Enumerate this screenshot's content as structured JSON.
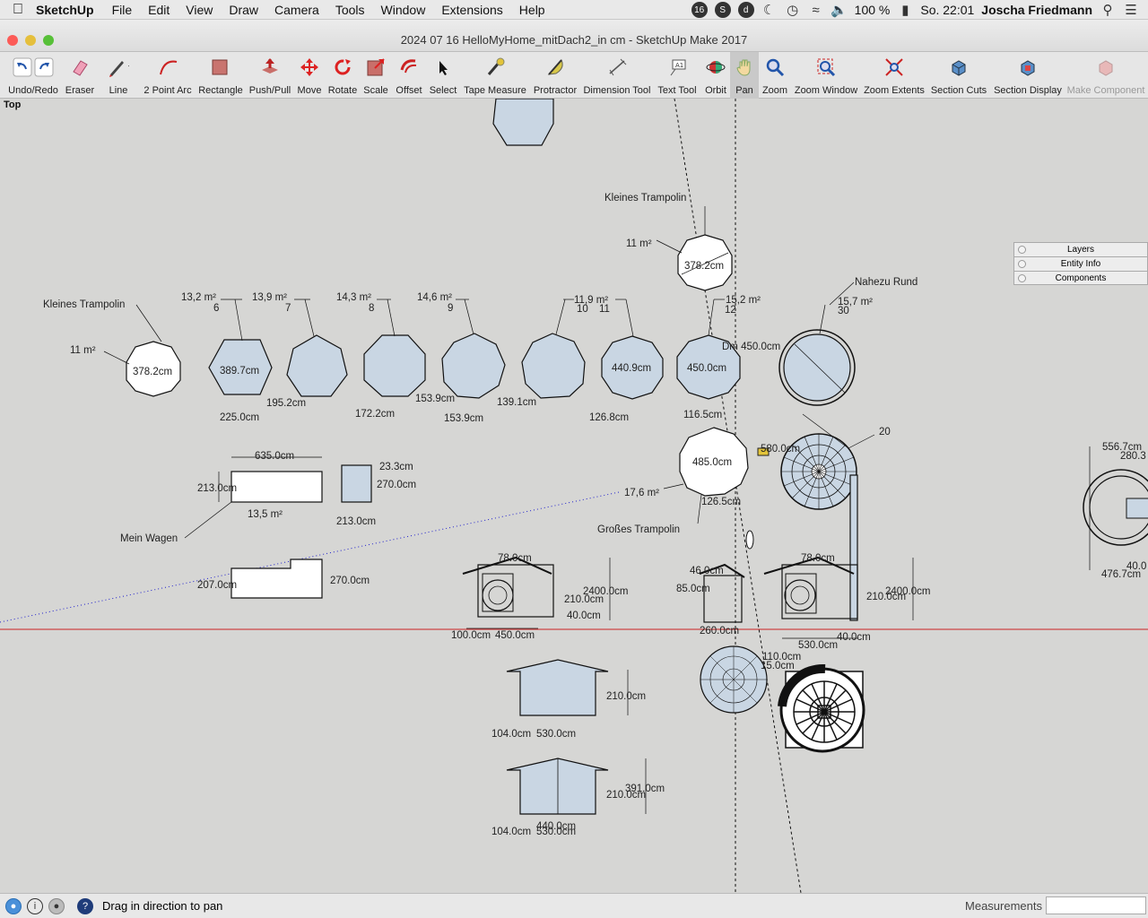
{
  "menubar": {
    "app_name": "SketchUp",
    "items": [
      "File",
      "Edit",
      "View",
      "Draw",
      "Camera",
      "Tools",
      "Window",
      "Extensions",
      "Help"
    ],
    "battery": "100 %",
    "clock": "So. 22:01",
    "user": "Joscha Friedmann"
  },
  "window": {
    "title": "2024 07 16 HelloMyHome_mitDach2_in cm - SketchUp Make 2017"
  },
  "toolbar": {
    "tools": [
      {
        "label": "Undo/Redo",
        "icon": "undo-redo-icon"
      },
      {
        "label": "Eraser",
        "icon": "eraser-icon"
      },
      {
        "label": "Line",
        "icon": "pencil-icon"
      },
      {
        "label": "2 Point Arc",
        "icon": "arc-icon"
      },
      {
        "label": "Rectangle",
        "icon": "rectangle-icon"
      },
      {
        "label": "Push/Pull",
        "icon": "push-pull-icon"
      },
      {
        "label": "Move",
        "icon": "move-icon"
      },
      {
        "label": "Rotate",
        "icon": "rotate-icon"
      },
      {
        "label": "Scale",
        "icon": "scale-icon"
      },
      {
        "label": "Offset",
        "icon": "offset-icon"
      },
      {
        "label": "Select",
        "icon": "arrow-icon"
      },
      {
        "label": "Tape Measure",
        "icon": "tape-measure-icon"
      },
      {
        "label": "Protractor",
        "icon": "protractor-icon"
      },
      {
        "label": "Dimension Tool",
        "icon": "dimension-icon"
      },
      {
        "label": "Text Tool",
        "icon": "text-icon"
      },
      {
        "label": "Orbit",
        "icon": "orbit-icon"
      },
      {
        "label": "Pan",
        "icon": "hand-icon"
      },
      {
        "label": "Zoom",
        "icon": "magnifier-icon"
      },
      {
        "label": "Zoom Window",
        "icon": "zoom-window-icon"
      },
      {
        "label": "Zoom Extents",
        "icon": "zoom-extents-icon"
      },
      {
        "label": "Section Cuts",
        "icon": "section-cuts-icon"
      },
      {
        "label": "Section Display",
        "icon": "section-display-icon"
      },
      {
        "label": "Make Component",
        "icon": "component-icon"
      }
    ]
  },
  "viewport": {
    "view_name": "Top",
    "labels": {
      "kt_top": "Kleines Trampolin",
      "kt_top_area": "11 m²",
      "kt_top_diam": "378.2cm",
      "kt_left": "Kleines Trampolin",
      "kt_left_area": "11 m²",
      "kt_left_diam": "378.2cm",
      "rund": "Nahezu Rund",
      "a1": "13,2 m²",
      "n1": "6",
      "a2": "13,9 m²",
      "n2": "7",
      "a3": "14,3 m²",
      "n3": "8",
      "a4": "14,6 m²",
      "n4": "9",
      "a5": "11,9 m²",
      "n5": "10",
      "n6": "11",
      "a7": "15,2 m²",
      "n7": "12",
      "a8": "15,7 m²",
      "n8": "30",
      "d1": "389.7cm",
      "d2": "440.9cm",
      "d3": "450.0cm",
      "d4": "Dm 450.0cm",
      "s1": "225.0cm",
      "s2": "195.2cm",
      "s3": "172.2cm",
      "s4": "153.9cm",
      "s5": "153.9cm",
      "s6": "139.1cm",
      "s7": "126.8cm",
      "s8": "116.5cm",
      "gt_diam": "485.0cm",
      "gt_area": "17,6 m²",
      "gt_side": "126.5cm",
      "gt_label": "Großes Trampolin",
      "n20": "20",
      "m580": "580.0cm",
      "w_len": "635.0cm",
      "w_wid": "213.0cm",
      "w_area": "13,5 m²",
      "w_label": "Mein Wagen",
      "s_w": "213.0cm",
      "s_h": "23.3cm",
      "s_h2": "270.0cm",
      "w2_h": "207.0cm",
      "w2_w": "270.0cm",
      "rm1": "556.7cm",
      "rm2": "280.3",
      "rm3": "476.7cm",
      "rm4": "40.0",
      "h1_a": "450.0cm",
      "h1_b": "100.0cm",
      "h1_c": "210.0cm",
      "h1_d": "2400.0cm",
      "h1_e": "40.0cm",
      "h1_f": "78.0cm",
      "h2_a": "530.0cm",
      "h2_b": "40.0cm",
      "h2_c": "210.0cm",
      "h2_d": "2400.0cm",
      "h2_e": "78.0cm",
      "c_a": "85.0cm",
      "c_b": "260.0cm",
      "c_c": "46.0cm",
      "bc_a": "110.0cm",
      "bc_b": "15.0cm",
      "b1_h": "210.0cm",
      "b1_w": "530.0cm",
      "b1_l": "104.0cm",
      "b2_h": "210.0cm",
      "b2_t": "391.0cm",
      "b2_w": "530.0cm",
      "b2_i": "440.0cm",
      "b2_l": "104.0cm"
    }
  },
  "trays": [
    "Layers",
    "Entity Info",
    "Components"
  ],
  "status": {
    "message": "Drag in direction to pan",
    "measurements_label": "Measurements",
    "measurements_value": ""
  },
  "colors": {
    "face": "#c9d6e3",
    "face_white": "#ffffff",
    "edge": "#1a1a1a",
    "axis_red": "#cc2222",
    "axis_blue": "#2222cc",
    "background": "#d6d6d4"
  }
}
